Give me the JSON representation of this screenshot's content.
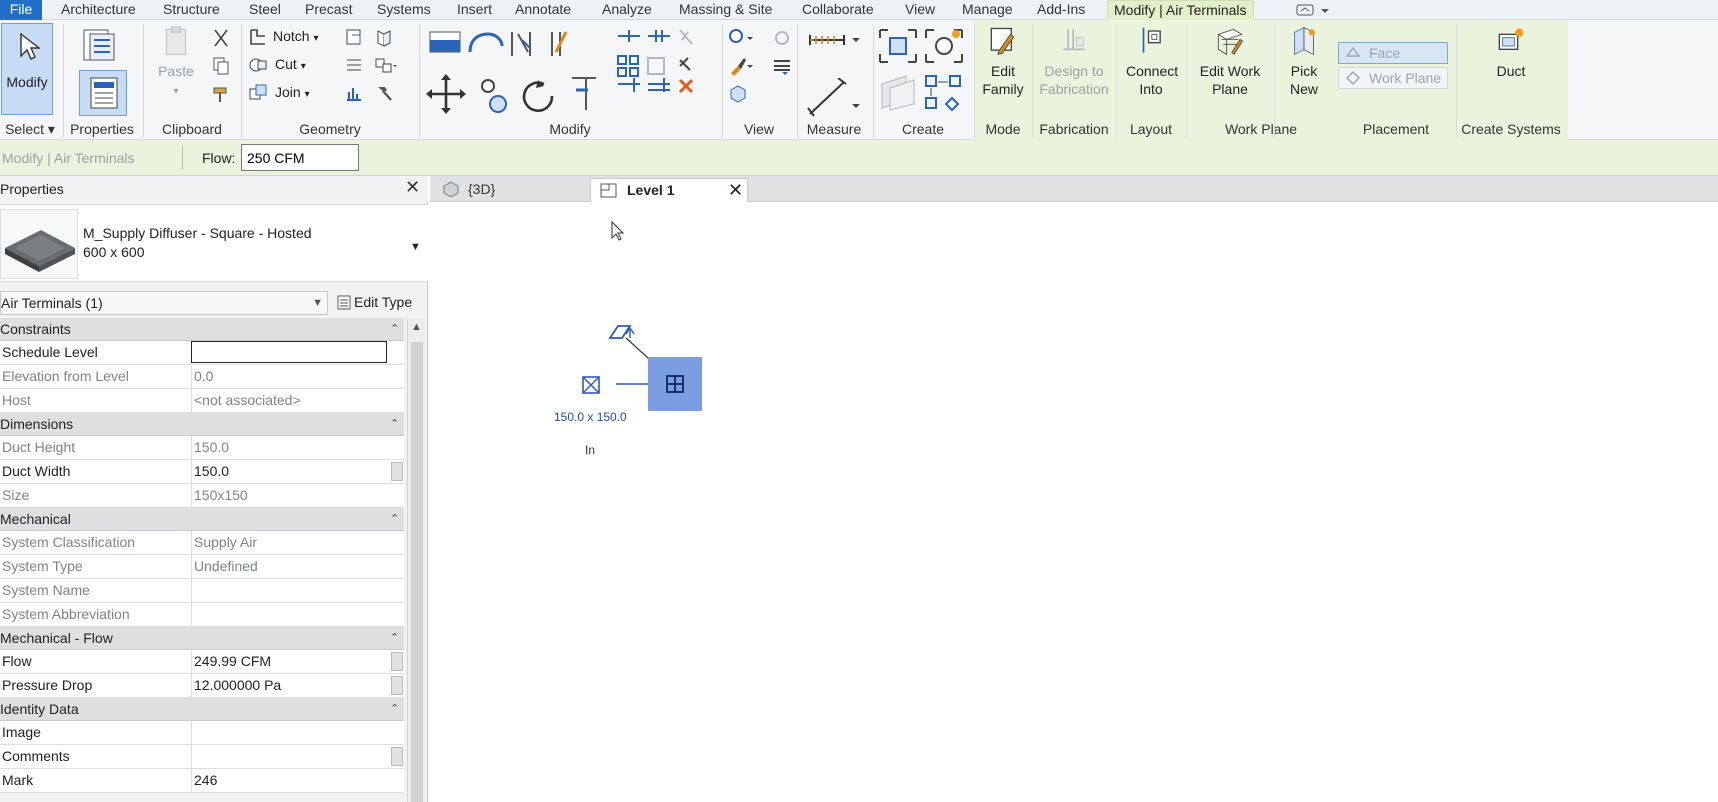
{
  "menu": {
    "file": "File",
    "tabs": [
      "Architecture",
      "Structure",
      "Steel",
      "Precast",
      "Systems",
      "Insert",
      "Annotate",
      "Analyze",
      "Massing & Site",
      "Collaborate",
      "View",
      "Manage",
      "Add-Ins"
    ],
    "active_tab": "Modify | Air Terminals"
  },
  "ribbon": {
    "modify": "Modify",
    "select_panel": "Select",
    "properties_panel": "Properties",
    "clipboard": {
      "label": "Clipboard",
      "paste": "Paste"
    },
    "geometry": {
      "label": "Geometry",
      "notch": "Notch",
      "cut": "Cut",
      "join": "Join"
    },
    "modify_panel": "Modify",
    "view_panel": "View",
    "measure_panel": "Measure",
    "create_panel": "Create",
    "mode": {
      "label": "Mode",
      "button": "Edit Family"
    },
    "fabrication": {
      "label": "Fabrication",
      "button": "Design to Fabrication"
    },
    "layout": {
      "label": "Layout",
      "button": "Connect Into"
    },
    "work_plane": {
      "label": "Work Plane",
      "button": "Edit Work Plane"
    },
    "placement": {
      "label": "Placement",
      "pick_new": "Pick New",
      "face": "Face",
      "work_plane": "Work Plane"
    },
    "create_systems": {
      "label": "Create Systems",
      "button": "Duct"
    }
  },
  "options_bar": {
    "context": "Modify | Air Terminals",
    "flow_label": "Flow:",
    "flow_value": "250 CFM"
  },
  "properties": {
    "title": "Properties",
    "type_name": "M_Supply Diffuser - Square - Hosted",
    "type_size": "600 x 600",
    "filter": "Air Terminals (1)",
    "edit_type": "Edit Type",
    "groups": [
      {
        "name": "Constraints",
        "rows": [
          {
            "k": "Schedule Level",
            "v": "",
            "ro": false,
            "edit": true
          },
          {
            "k": "Elevation from Level",
            "v": "0.0",
            "ro": true
          },
          {
            "k": "Host",
            "v": "<not associated>",
            "ro": true
          }
        ]
      },
      {
        "name": "Dimensions",
        "rows": [
          {
            "k": "Duct Height",
            "v": "150.0",
            "ro": true
          },
          {
            "k": "Duct Width",
            "v": "150.0",
            "ro": false,
            "btn": true
          },
          {
            "k": "Size",
            "v": "150x150",
            "ro": true
          }
        ]
      },
      {
        "name": "Mechanical",
        "rows": [
          {
            "k": "System Classification",
            "v": "Supply Air",
            "ro": true
          },
          {
            "k": "System Type",
            "v": "Undefined",
            "ro": true
          },
          {
            "k": "System Name",
            "v": "",
            "ro": true
          },
          {
            "k": "System Abbreviation",
            "v": "",
            "ro": true
          }
        ]
      },
      {
        "name": "Mechanical - Flow",
        "rows": [
          {
            "k": "Flow",
            "v": "249.99 CFM",
            "ro": false,
            "btn": true
          },
          {
            "k": "Pressure Drop",
            "v": "12.000000 Pa",
            "ro": false,
            "btn": true
          }
        ]
      },
      {
        "name": "Identity Data",
        "rows": [
          {
            "k": "Image",
            "v": "",
            "ro": false
          },
          {
            "k": "Comments",
            "v": "",
            "ro": false,
            "btn": true
          },
          {
            "k": "Mark",
            "v": "246",
            "ro": false
          }
        ]
      }
    ]
  },
  "views": {
    "tab_3d": "{3D}",
    "tab_level": "Level 1"
  },
  "canvas": {
    "dimension": "150.0 x 150.0",
    "tag": "In"
  },
  "colors": {
    "file_tab": "#1f6fc9",
    "context_green": "#eaf4dd",
    "selection_blue": "#7b9ee3"
  }
}
